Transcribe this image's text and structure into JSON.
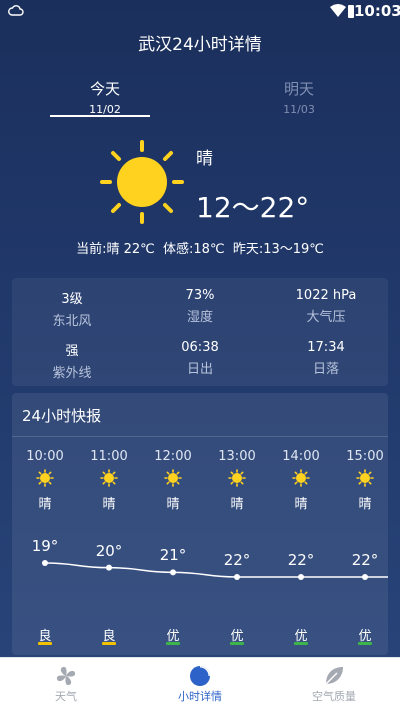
{
  "status": {
    "time": "10:03"
  },
  "title": "武汉24小时详情",
  "tabs": [
    {
      "label": "今天",
      "date": "11/02"
    },
    {
      "label": "明天",
      "date": "11/03"
    }
  ],
  "current": {
    "condition": "晴",
    "temp_range": "12～22°",
    "summary": "当前:晴 22℃  体感:18℃  昨天:13～19℃"
  },
  "details": [
    {
      "value": "3级",
      "label": "东北风"
    },
    {
      "value": "73%",
      "label": "湿度"
    },
    {
      "value": "1022 hPa",
      "label": "大气压"
    },
    {
      "value": "强",
      "label": "紫外线"
    },
    {
      "value": "06:38",
      "label": "日出"
    },
    {
      "value": "17:34",
      "label": "日落"
    }
  ],
  "hourly": {
    "title": "24小时快报",
    "items": [
      {
        "time": "10:00",
        "cond": "晴",
        "temp": "19°",
        "temp_value": 19,
        "aqi": "良"
      },
      {
        "time": "11:00",
        "cond": "晴",
        "temp": "20°",
        "temp_value": 20,
        "aqi": "良"
      },
      {
        "time": "12:00",
        "cond": "晴",
        "temp": "21°",
        "temp_value": 21,
        "aqi": "优"
      },
      {
        "time": "13:00",
        "cond": "晴",
        "temp": "22°",
        "temp_value": 22,
        "aqi": "优"
      },
      {
        "time": "14:00",
        "cond": "晴",
        "temp": "22°",
        "temp_value": 22,
        "aqi": "优"
      },
      {
        "time": "15:00",
        "cond": "晴",
        "temp": "22°",
        "temp_value": 22,
        "aqi": "优"
      }
    ]
  },
  "colors": {
    "aqi_good": "#f2c200",
    "aqi_excellent": "#3bb54a",
    "sun": "#ffd21f",
    "nav_active": "#2d63c8"
  },
  "nav": [
    {
      "label": "天气",
      "icon": "fan-icon"
    },
    {
      "label": "小时详情",
      "icon": "pie-clock-icon"
    },
    {
      "label": "空气质量",
      "icon": "leaf-icon"
    }
  ]
}
